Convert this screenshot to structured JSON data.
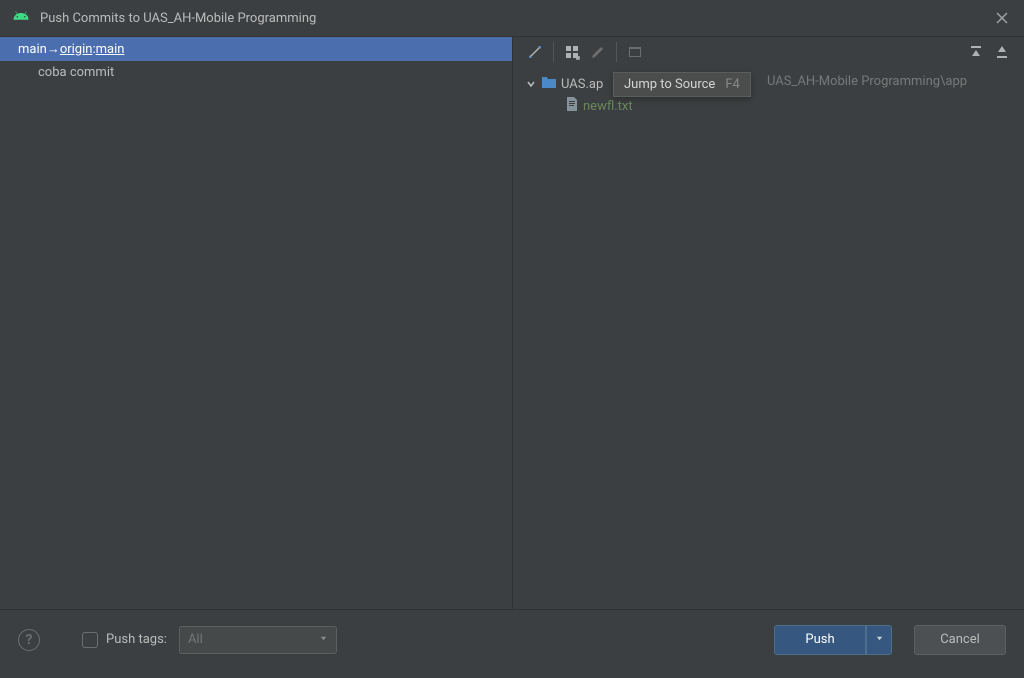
{
  "window": {
    "title": "Push Commits to UAS_AH-Mobile Programming"
  },
  "branch": {
    "local": "main",
    "arrow": " → ",
    "remote": "origin",
    "sep": " : ",
    "target": "main"
  },
  "commits": [
    {
      "message": "coba commit"
    }
  ],
  "tooltip": {
    "label": "Jump to Source",
    "shortcut": "F4"
  },
  "tree": {
    "root_name_visible_prefix": "UAS.ap",
    "root_path_suffix": "UAS_AH-Mobile Programming\\app",
    "files": [
      {
        "name": "newfl.txt",
        "status": "added"
      }
    ]
  },
  "footer": {
    "push_tags_label": "Push tags:",
    "push_tags_value": "All",
    "push_label": "Push",
    "cancel_label": "Cancel"
  }
}
